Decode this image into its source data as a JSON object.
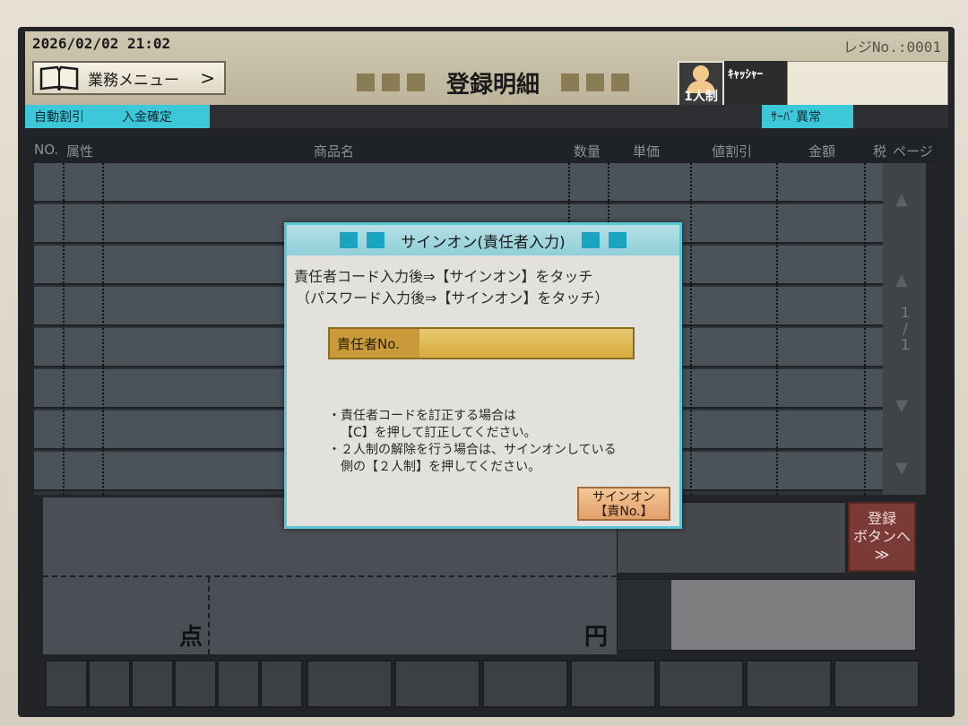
{
  "header": {
    "datetime": "2026/02/02  21:02",
    "register_no": "レジNo.:0001",
    "menu_button": "業務メニュー",
    "menu_chevron": ">",
    "title": "登録明細",
    "mode_badge": "1人制",
    "cashier_label": "ｷｬｯｼｬｰ",
    "cashier_value": ""
  },
  "status": {
    "auto_discount": "自動割引",
    "deposit_confirm": "入金確定",
    "server_status": "ｻｰﾊﾞ異常"
  },
  "table": {
    "columns": {
      "no": "NO.",
      "attr": "属性",
      "product": "商品名",
      "qty": "数量",
      "unit_price": "単価",
      "discount": "値割引",
      "amount": "金額",
      "tax": "税",
      "page": "ページ"
    },
    "page_indicator": "1\n/\n1"
  },
  "summary": {
    "points_unit": "点",
    "yen_unit": "円"
  },
  "register_button": {
    "line1": "登録",
    "line2": "ボタンへ",
    "line3": "≫"
  },
  "dialog": {
    "title": "サインオン(責任者入力)",
    "instruction1": "責任者コード入力後⇒【サインオン】をタッチ",
    "instruction2": "（パスワード入力後⇒【サインオン】をタッチ）",
    "manager_label": "責任者No.",
    "manager_value": "",
    "note1a": "・責任者コードを訂正する場合は",
    "note1b": "【C】を押して訂正してください。",
    "note2a": "・２人制の解除を行う場合は、サインオンしている",
    "note2b": "側の【２人制】を押してください。",
    "signon_line1": "サインオン",
    "signon_line2": "【責No.】"
  },
  "colors": {
    "accent_cyan": "#3cc8d8",
    "register_button": "#7a3a36",
    "manager_field": "#d6ac40"
  }
}
